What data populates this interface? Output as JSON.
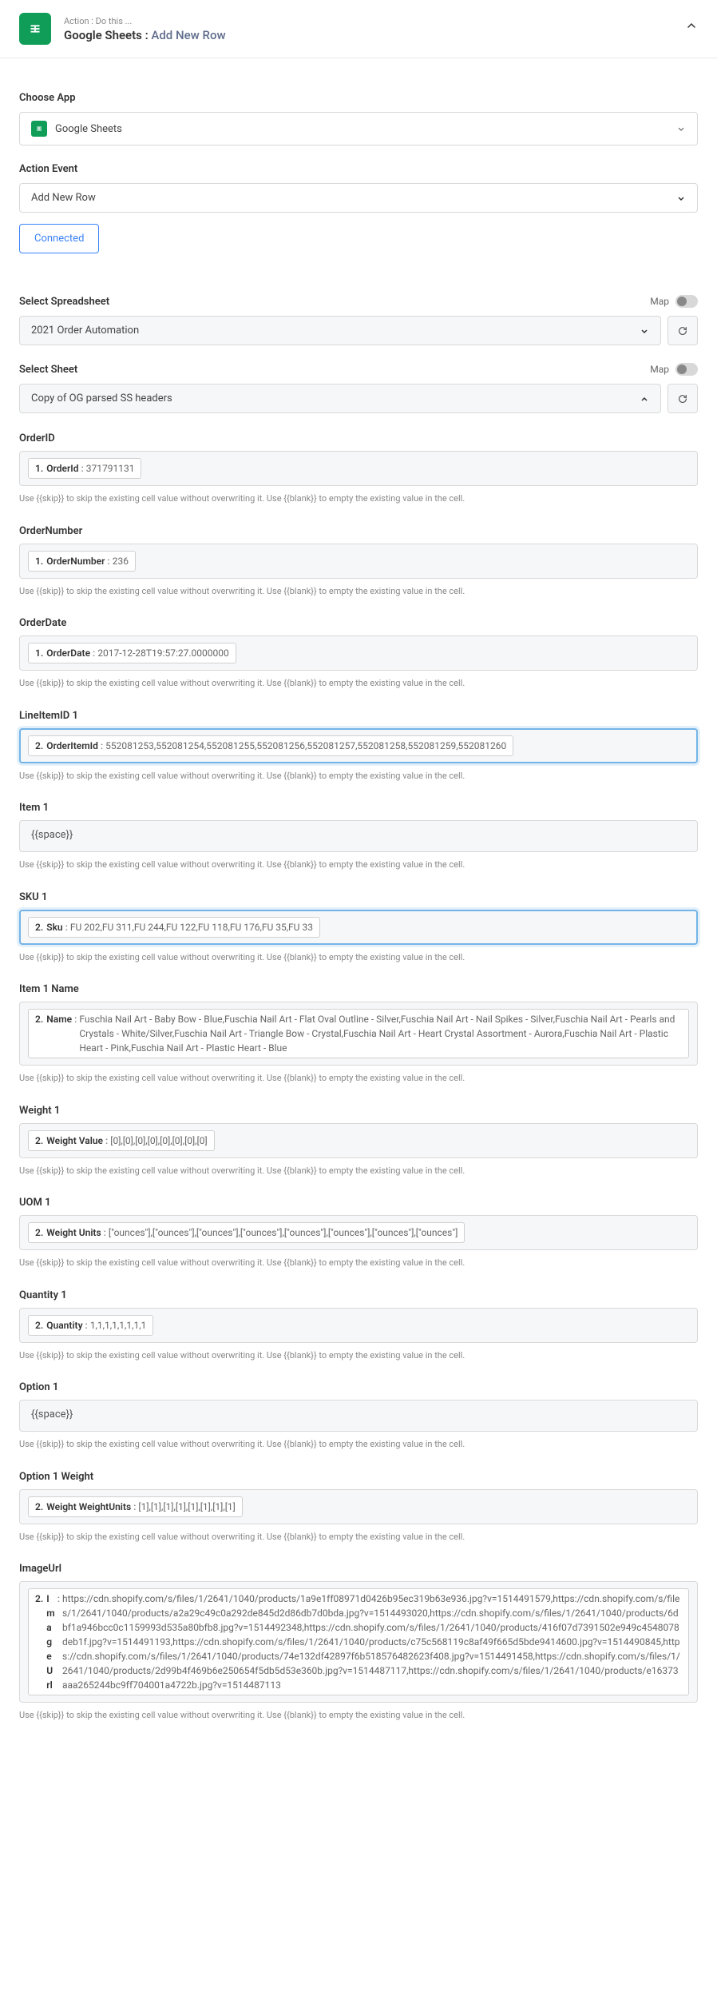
{
  "header": {
    "subtitle": "Action : Do this ...",
    "app_name": "Google Sheets : ",
    "action": "Add New Row"
  },
  "choose_app": {
    "label": "Choose App",
    "value": "Google Sheets"
  },
  "action_event": {
    "label": "Action Event",
    "value": "Add New Row"
  },
  "connected_label": "Connected",
  "map_label": "Map",
  "spreadsheet": {
    "label": "Select Spreadsheet",
    "value": "2021 Order Automation"
  },
  "sheet": {
    "label": "Select Sheet",
    "value": "Copy of OG parsed SS headers"
  },
  "helper": "Use {{skip}} to skip the existing cell value without overwriting it. Use {{blank}} to empty the existing value in the cell.",
  "fields": {
    "order_id": {
      "label": "OrderID",
      "num": "1.",
      "key": "OrderId",
      "val": "371791131"
    },
    "order_number": {
      "label": "OrderNumber",
      "num": "1.",
      "key": "OrderNumber",
      "val": "236"
    },
    "order_date": {
      "label": "OrderDate",
      "num": "1.",
      "key": "OrderDate",
      "val": "2017-12-28T19:57:27.0000000"
    },
    "line_item_id": {
      "label": "LineItemID 1",
      "num": "2.",
      "key": "OrderItemId",
      "val": "552081253,552081254,552081255,552081256,552081257,552081258,552081259,552081260"
    },
    "item1": {
      "label": "Item 1",
      "template": "{{space}}"
    },
    "sku1": {
      "label": "SKU 1",
      "num": "2.",
      "key": "Sku",
      "val": "FU 202,FU 311,FU 244,FU 122,FU 118,FU 176,FU 35,FU 33"
    },
    "item1_name": {
      "label": "Item 1 Name",
      "num": "2.",
      "key": "Name",
      "val": "Fuschia Nail Art - Baby Bow - Blue,Fuschia Nail Art - Flat Oval Outline - Silver,Fuschia Nail Art - Nail Spikes - Silver,Fuschia Nail Art - Pearls and Crystals - White/Silver,Fuschia Nail Art - Triangle Bow - Crystal,Fuschia Nail Art - Heart Crystal Assortment - Aurora,Fuschia Nail Art - Plastic Heart - Pink,Fuschia Nail Art - Plastic Heart - Blue"
    },
    "weight1": {
      "label": "Weight 1",
      "num": "2.",
      "key": "Weight Value",
      "val": "[0],[0],[0],[0],[0],[0],[0],[0]"
    },
    "uom1": {
      "label": "UOM 1",
      "num": "2.",
      "key": "Weight Units",
      "val": "[\"ounces\"],[\"ounces\"],[\"ounces\"],[\"ounces\"],[\"ounces\"],[\"ounces\"],[\"ounces\"],[\"ounces\"]"
    },
    "quantity1": {
      "label": "Quantity 1",
      "num": "2.",
      "key": "Quantity",
      "val": "1,1,1,1,1,1,1,1"
    },
    "option1": {
      "label": "Option 1",
      "template": "{{space}}"
    },
    "option1_weight": {
      "label": "Option 1 Weight",
      "num": "2.",
      "key": "Weight WeightUnits",
      "val": "[1],[1],[1],[1],[1],[1],[1],[1]"
    },
    "image_url": {
      "label": "ImageUrl",
      "num": "2.",
      "key": "ImageUrl",
      "val": "https://cdn.shopify.com/s/files/1/2641/1040/products/1a9e1ff08971d0426b95ec319b63e936.jpg?v=1514491579,https://cdn.shopify.com/s/files/1/2641/1040/products/a2a29c49c0a292de845d2d86db7d0bda.jpg?v=1514493020,https://cdn.shopify.com/s/files/1/2641/1040/products/6dbf1a946bcc0c1159993d535a80bfb8.jpg?v=1514492348,https://cdn.shopify.com/s/files/1/2641/1040/products/416f07d7391502e949c4548078deb1f.jpg?v=1514491193,https://cdn.shopify.com/s/files/1/2641/1040/products/c75c568119c8af49f665d5bde9414600.jpg?v=1514490845,https://cdn.shopify.com/s/files/1/2641/1040/products/74e132df42897f6b518576482623f408.jpg?v=1514491458,https://cdn.shopify.com/s/files/1/2641/1040/products/2d99b4f469b6e250654f5db5d53e360b.jpg?v=1514487117,https://cdn.shopify.com/s/files/1/2641/1040/products/e16373aaa265244bc9ff704001a4722b.jpg?v=1514487113"
    }
  }
}
